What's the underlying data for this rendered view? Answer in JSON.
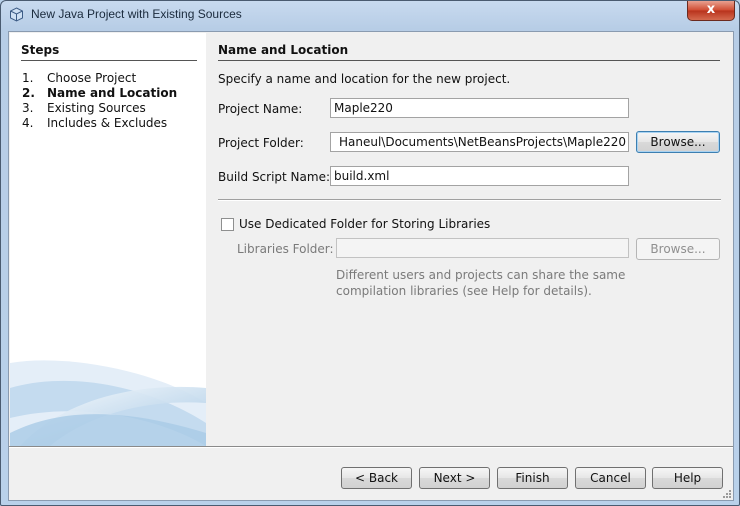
{
  "window": {
    "title": "New Java Project with Existing Sources",
    "close_glyph": "x"
  },
  "steps": {
    "heading": "Steps",
    "items": [
      {
        "num": "1.",
        "label": "Choose Project"
      },
      {
        "num": "2.",
        "label": "Name and Location"
      },
      {
        "num": "3.",
        "label": "Existing Sources"
      },
      {
        "num": "4.",
        "label": "Includes & Excludes"
      }
    ],
    "current_index": 1
  },
  "panel": {
    "heading": "Name and Location",
    "description": "Specify a name and location for the new project.",
    "project_name_label": "Project Name:",
    "project_name_value": "Maple220",
    "project_folder_label": "Project Folder:",
    "project_folder_value": "Haneul\\Documents\\NetBeansProjects\\Maple220",
    "browse_label": "Browse...",
    "build_script_label": "Build Script Name:",
    "build_script_value": "build.xml",
    "dedicated_folder_label": "Use Dedicated Folder for Storing Libraries",
    "dedicated_folder_checked": false,
    "libraries_folder_label": "Libraries Folder:",
    "libraries_folder_value": "",
    "libraries_browse_label": "Browse...",
    "libraries_hint_line1": "Different users and projects can share the same",
    "libraries_hint_line2": "compilation libraries (see Help for details)."
  },
  "buttons": {
    "back": "< Back",
    "next": "Next >",
    "finish": "Finish",
    "cancel": "Cancel",
    "help": "Help"
  },
  "icons": {
    "app": "java-project-cube-icon",
    "close": "close-icon"
  },
  "colors": {
    "title_bar": "#b9d1ea",
    "close_button": "#cf4a30",
    "focus_ring": "#3c7fb1"
  }
}
